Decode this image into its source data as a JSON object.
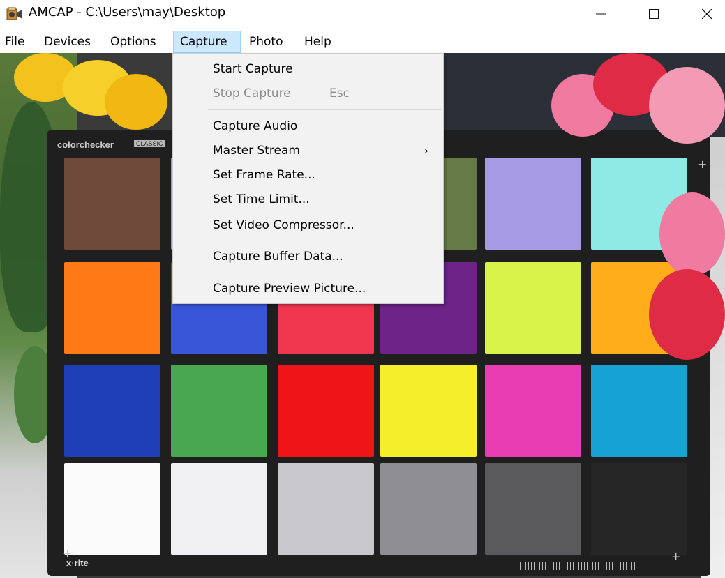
{
  "window": {
    "title": "AMCAP - C:\\Users\\may\\Desktop",
    "icon": "camera-app-icon",
    "controls": {
      "minimize": "—",
      "maximize": "☐",
      "close": "✕"
    }
  },
  "menubar": {
    "items": [
      "File",
      "Devices",
      "Options",
      "Capture",
      "Photo",
      "Help"
    ],
    "active": "Capture"
  },
  "capture_menu": {
    "items": [
      {
        "label": "Start Capture",
        "enabled": true
      },
      {
        "label": "Stop Capture",
        "shortcut": "Esc",
        "enabled": false
      },
      {
        "label": "Capture Audio",
        "enabled": true
      },
      {
        "label": "Master Stream",
        "submenu": "›",
        "enabled": true
      },
      {
        "label": "Set Frame Rate...",
        "enabled": true
      },
      {
        "label": "Set Time Limit...",
        "enabled": true
      },
      {
        "label": "Set Video Compressor...",
        "enabled": true
      },
      {
        "label": "Capture Buffer Data...",
        "enabled": true
      },
      {
        "label": "Capture Preview Picture...",
        "enabled": true
      }
    ]
  },
  "preview": {
    "chart_brand": "colorchecker",
    "chart_badge": "CLASSIC",
    "maker": "x·rite",
    "patch_colors": [
      [
        "#6f4a3a",
        "#c9967f",
        "#6a7fa0",
        "#667a45",
        "#a89be6",
        "#8fe9e4"
      ],
      [
        "#ff7a14",
        "#3a56d8",
        "#f0374f",
        "#6e2386",
        "#d9f249",
        "#ffad1a"
      ],
      [
        "#1f3fb8",
        "#49a84f",
        "#ee1418",
        "#f5ee2a",
        "#e83cb2",
        "#17a2d6"
      ],
      [
        "#fafafa",
        "#f0eff2",
        "#c8c8cc",
        "#8f8f93",
        "#5a5a5c",
        "#262626"
      ]
    ]
  }
}
